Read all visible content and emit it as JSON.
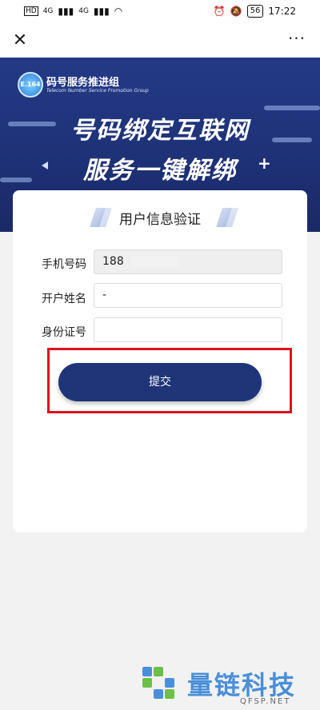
{
  "status_bar": {
    "sim1": "HD",
    "sim2": "HD",
    "network1": "4G",
    "network2": "4G",
    "battery": "56",
    "time": "17:22"
  },
  "topbar": {
    "close_label": "✕",
    "more_label": "···"
  },
  "banner": {
    "logo_text": "E.164",
    "org_name": "码号服务推进组",
    "org_subtitle": "Telecom Number Service  Promotion Group",
    "headline_1": "号码绑定互联网",
    "headline_2": "服务一键解绑",
    "headline_plus": "+",
    "bg_color": "#243a86"
  },
  "form": {
    "title": "用户信息验证",
    "phone_label": "手机号码",
    "phone_value": "188",
    "name_label": "开户姓名",
    "name_value": "-",
    "id_label": "身份证号",
    "id_value": "",
    "submit_label": "提交",
    "submit_color": "#1f3578",
    "highlight_color": "#e0101e"
  },
  "watermark": {
    "brand": "量链科技",
    "domain": "QFSP.NET",
    "color": "#4a8fd9"
  }
}
